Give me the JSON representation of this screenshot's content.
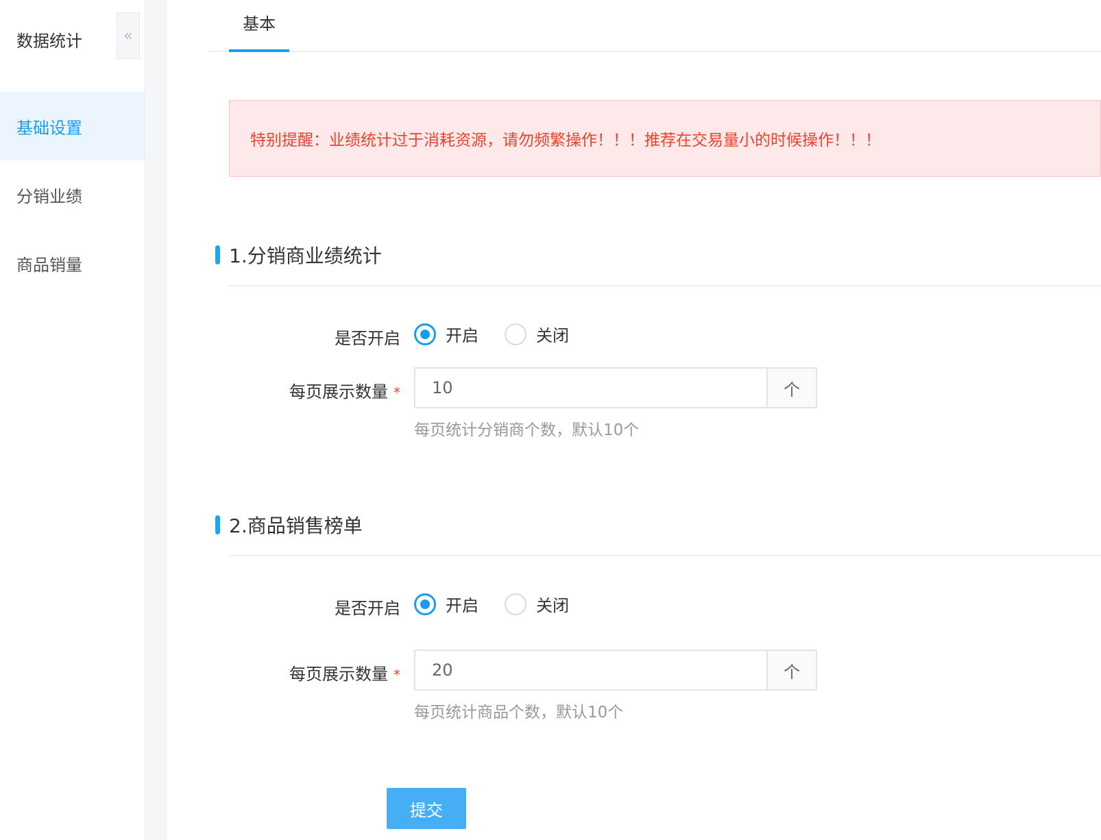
{
  "sidebar": {
    "title": "数据统计",
    "collapse_icon": "«",
    "items": [
      {
        "label": "基础设置",
        "active": true
      },
      {
        "label": "分销业绩",
        "active": false
      },
      {
        "label": "商品销量",
        "active": false
      }
    ]
  },
  "tabs": [
    {
      "label": "基本",
      "active": true
    }
  ],
  "alert": {
    "text": "特别提醒：业绩统计过于消耗资源，请勿频繁操作！！！推荐在交易量小的时候操作！！！"
  },
  "sections": [
    {
      "title": "1.分销商业绩统计",
      "enable_label": "是否开启",
      "options": {
        "on": "开启",
        "off": "关闭",
        "selected": "开启"
      },
      "count_label": "每页展示数量",
      "required_mark": "*",
      "count_value": "10",
      "unit": "个",
      "help": "每页统计分销商个数，默认10个"
    },
    {
      "title": "2.商品销售榜单",
      "enable_label": "是否开启",
      "options": {
        "on": "开启",
        "off": "关闭",
        "selected": "开启"
      },
      "count_label": "每页展示数量",
      "required_mark": "*",
      "count_value": "20",
      "unit": "个",
      "help": "每页统计商品个数，默认10个"
    }
  ],
  "submit_label": "提交",
  "colors": {
    "accent": "#1a9cf0",
    "alert_text": "#e8442e",
    "alert_bg": "#fde9e9",
    "button": "#46aef5"
  }
}
